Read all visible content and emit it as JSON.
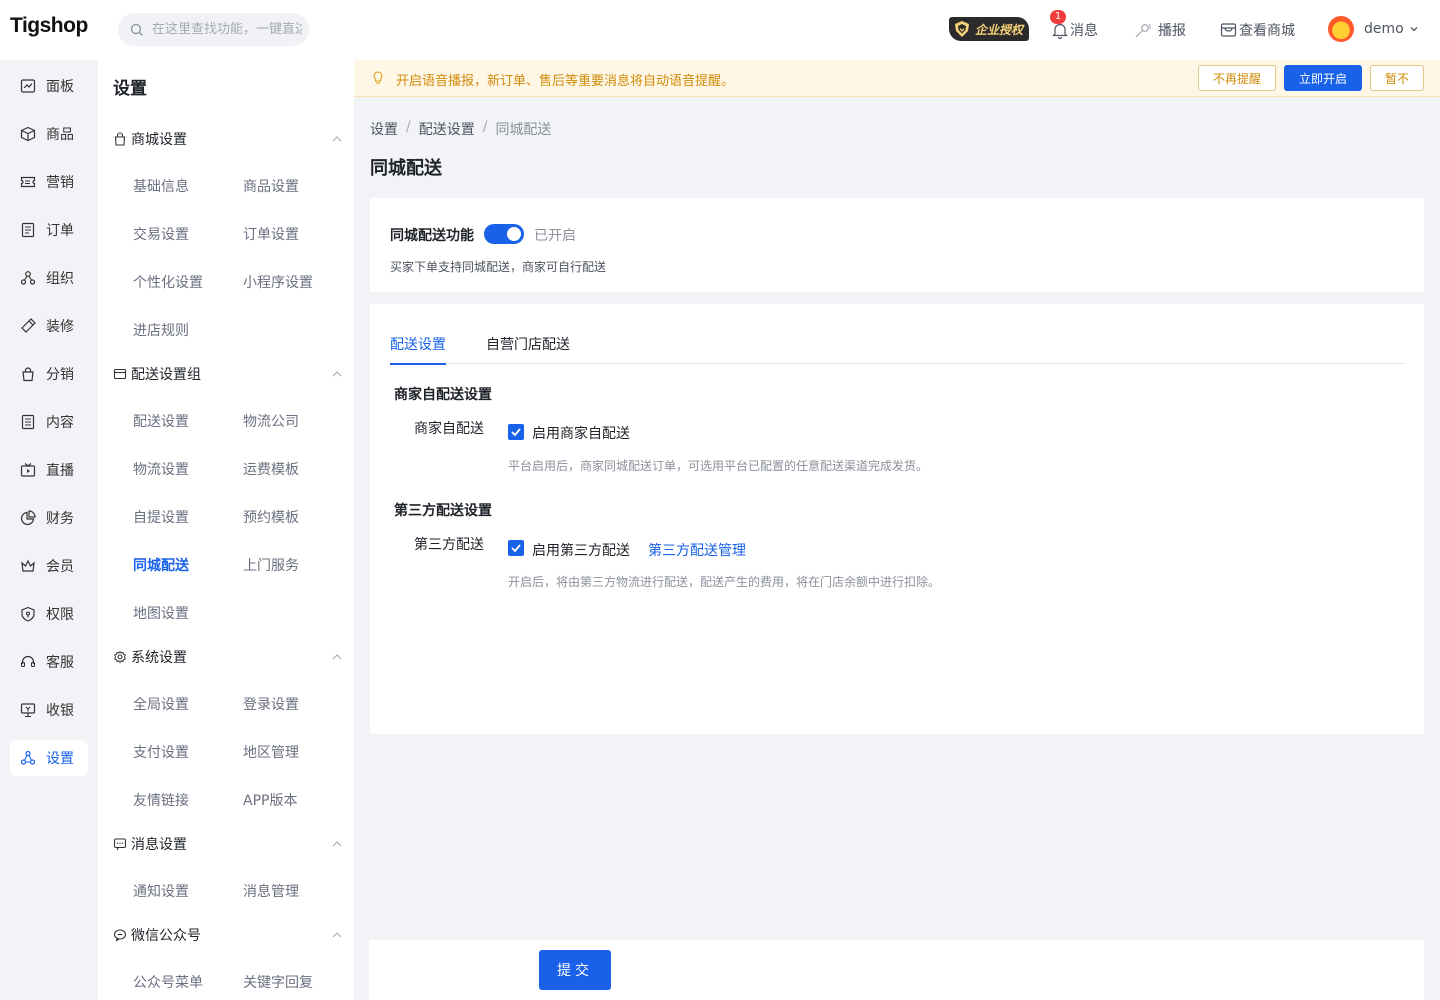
{
  "header": {
    "logo": "Tigshop",
    "search_placeholder": "在这里查找功能，一键直达",
    "license_label": "企业授权",
    "messages_label": "消息",
    "messages_badge": "1",
    "broadcast_label": "播报",
    "view_store_label": "查看商城",
    "username": "demo"
  },
  "nav": {
    "items": [
      {
        "label": "面板",
        "icon": "dashboard-icon"
      },
      {
        "label": "商品",
        "icon": "box-icon"
      },
      {
        "label": "营销",
        "icon": "ticket-icon"
      },
      {
        "label": "订单",
        "icon": "order-icon"
      },
      {
        "label": "组织",
        "icon": "org-icon"
      },
      {
        "label": "装修",
        "icon": "brush-icon"
      },
      {
        "label": "分销",
        "icon": "bag-icon"
      },
      {
        "label": "内容",
        "icon": "document-icon"
      },
      {
        "label": "直播",
        "icon": "live-icon"
      },
      {
        "label": "财务",
        "icon": "pie-icon"
      },
      {
        "label": "会员",
        "icon": "crown-icon"
      },
      {
        "label": "权限",
        "icon": "shield-icon"
      },
      {
        "label": "客服",
        "icon": "headset-icon"
      },
      {
        "label": "收银",
        "icon": "cashier-icon"
      },
      {
        "label": "设置",
        "icon": "settings-icon"
      }
    ],
    "active": "设置"
  },
  "submenu": {
    "title": "设置",
    "groups": [
      {
        "title": "商城设置",
        "items": [
          "基础信息",
          "商品设置",
          "交易设置",
          "订单设置",
          "个性化设置",
          "小程序设置",
          "进店规则"
        ]
      },
      {
        "title": "配送设置组",
        "items": [
          "配送设置",
          "物流公司",
          "物流设置",
          "运费模板",
          "自提设置",
          "预约模板",
          "同城配送",
          "上门服务",
          "地图设置"
        ]
      },
      {
        "title": "系统设置",
        "items": [
          "全局设置",
          "登录设置",
          "支付设置",
          "地区管理",
          "友情链接",
          "APP版本"
        ]
      },
      {
        "title": "消息设置",
        "items": [
          "通知设置",
          "消息管理"
        ]
      },
      {
        "title": "微信公众号",
        "items": [
          "公众号菜单",
          "关键字回复"
        ]
      }
    ],
    "active_item": "同城配送"
  },
  "notice": {
    "text": "开启语音播报，新订单、售后等重要消息将自动语音提醒。",
    "btn_no_remind": "不再提醒",
    "btn_enable": "立即开启",
    "btn_later": "暂不"
  },
  "breadcrumb": [
    "设置",
    "配送设置",
    "同城配送"
  ],
  "page_title": "同城配送",
  "feature": {
    "label": "同城配送功能",
    "enabled": true,
    "status": "已开启",
    "description": "买家下单支持同城配送，商家可自行配送"
  },
  "tabs": [
    "配送设置",
    "自营门店配送"
  ],
  "active_tab": "配送设置",
  "merchant": {
    "section_title": "商家自配送设置",
    "field_label": "商家自配送",
    "checkbox_label": "启用商家自配送",
    "checked": true,
    "description": "平台启用后，商家同城配送订单，可选用平台已配置的任意配送渠道完成发货。"
  },
  "third_party": {
    "section_title": "第三方配送设置",
    "field_label": "第三方配送",
    "checkbox_label": "启用第三方配送",
    "checked": true,
    "link": "第三方配送管理",
    "description": "开启后，将由第三方物流进行配送，配送产生的费用，将在门店余额中进行扣除。"
  },
  "submit_label": "提交",
  "colors": {
    "primary": "#1861e8",
    "notice_bg": "#fef7e6",
    "notice_text": "#d08b0a"
  }
}
